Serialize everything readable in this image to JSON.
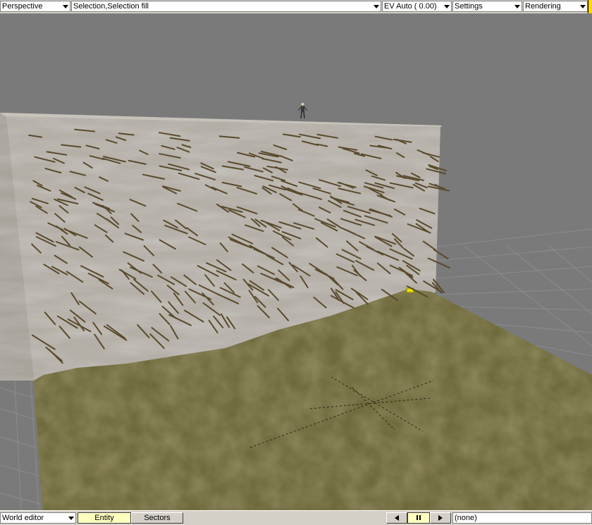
{
  "toolbar": {
    "view_mode": "Perspective",
    "selection_mode": "Selection,Selection fill",
    "exposure": "EV Auto ( 0.00)",
    "settings": "Settings",
    "rendering": "Rendering"
  },
  "bottom": {
    "editor_mode": "World editor",
    "tab_entity": "Entity",
    "tab_sectors": "Sectors",
    "status": "(none)"
  },
  "icons": {
    "prev": "triangle-left-icon",
    "pause": "pause-icon",
    "next": "triangle-right-icon",
    "dropdown": "chevron-down-icon"
  },
  "colors": {
    "toolbar_bg": "#d4d0c8",
    "viewport_bg": "#7a7a7a",
    "active_tab": "#ffffc0",
    "ground": "#6e6a3c",
    "cliff": "#b3aea6",
    "marker": "#ffd800"
  }
}
